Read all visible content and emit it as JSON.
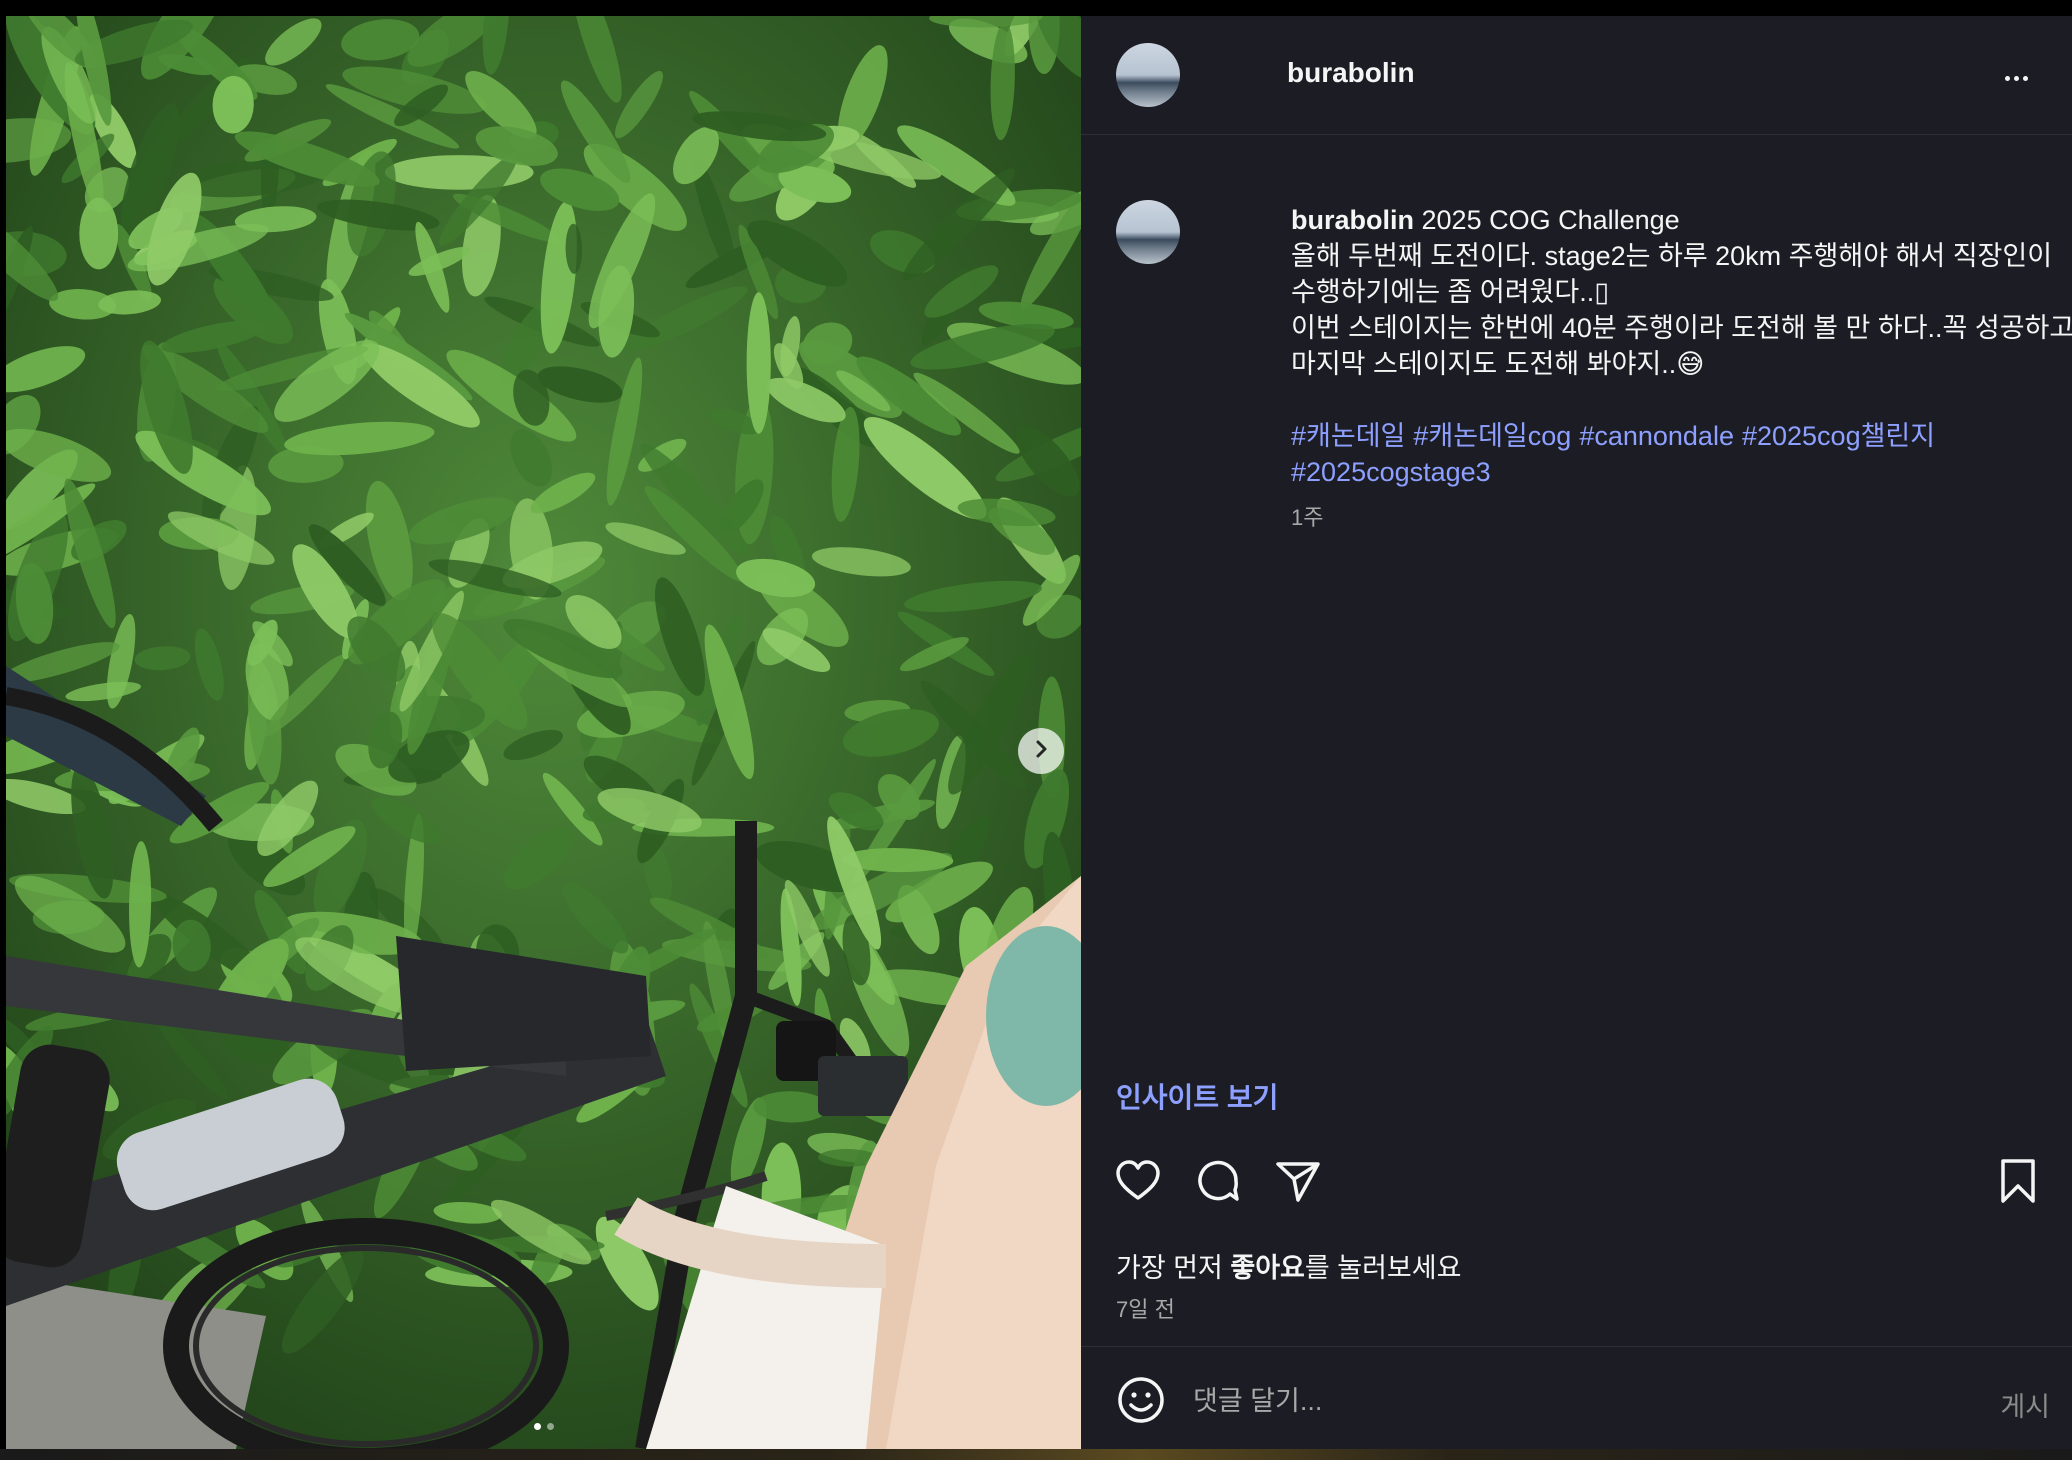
{
  "post": {
    "username": "burabolin",
    "caption": {
      "title": "2025 COG Challenge",
      "line1": "올해 두번째 도전이다. stage2는 하루 20km 주행해야 해서 직장인이 수행하기에는 좀 어려웠다..",
      "line1_glyph": "▯",
      "line2": "이번 스테이지는 한번에 40분 주행이라 도전해 볼 만 하다..꼭 성공하고 마지막 스테이지도 도전해 봐야지..",
      "line2_emoji": "😅"
    },
    "hashtags": [
      "#캐논데일",
      "#캐논데일cog",
      "#cannondale",
      "#2025cog챌린지",
      "#2025cogstage3"
    ],
    "caption_time": "1주",
    "insight_label": "인사이트 보기",
    "likes_prefix": "가장 먼저 ",
    "likes_bold": "좋아요",
    "likes_suffix": "를 눌러보세요",
    "date": "7일 전",
    "comment_placeholder": "댓글 달기...",
    "post_label": "게시",
    "carousel": {
      "slides": 2,
      "current": 1
    }
  },
  "colors": {
    "background": "#1c1d24",
    "link": "#8ea0ff",
    "muted": "#a8a8a8",
    "text": "#f5f5f5"
  },
  "icons": {
    "more": "more-horizontal-icon",
    "like": "heart-icon",
    "comment": "comment-bubble-icon",
    "share": "paper-plane-icon",
    "save": "bookmark-icon",
    "emoji": "smiley-icon",
    "next": "chevron-right-icon"
  }
}
